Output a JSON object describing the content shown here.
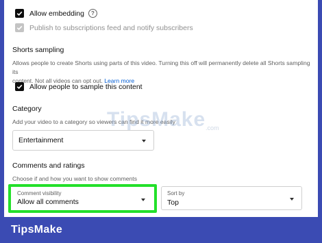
{
  "embedding": {
    "allow_embedding_label": "Allow embedding",
    "publish_label": "Publish to subscriptions feed and notify subscribers"
  },
  "shorts": {
    "title": "Shorts sampling",
    "description_line1": "Allows people to create Shorts using parts of this video. Turning this off will permanently delete all Shorts sampling its",
    "description_line2": "content. Not all videos can opt out.",
    "learn_more": "Learn more",
    "allow_label": "Allow people to sample this content"
  },
  "category": {
    "title": "Category",
    "description": "Add your video to a category so viewers can find it more easily",
    "selected": "Entertainment"
  },
  "comments": {
    "title": "Comments and ratings",
    "description": "Choose if and how you want to show comments",
    "visibility_label": "Comment visibility",
    "visibility_value": "Allow all comments",
    "sort_label": "Sort by",
    "sort_value": "Top"
  },
  "watermark": {
    "main": "TipsMake",
    "sub": ".com"
  },
  "brand": "TipsMake",
  "colors": {
    "highlight": "#23e02a",
    "frame": "#3b4bb3",
    "link": "#065fd4"
  }
}
